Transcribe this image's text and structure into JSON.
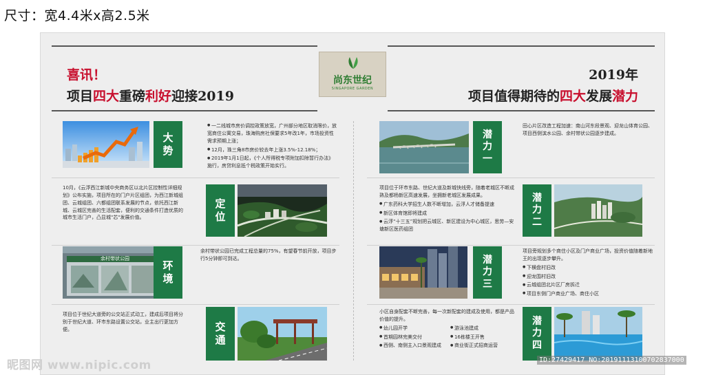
{
  "size_note": "尺寸：宽4.4米x高2.5米",
  "logo": {
    "cn": "尚东世纪",
    "en": "SINGAPORE GARDEN"
  },
  "title_left": {
    "line1": "喜讯！",
    "pre": "项目",
    "h1": "四大",
    "mid": "重磅",
    "h2": "利好",
    "post": "迎接2019"
  },
  "title_right": {
    "line1": "2019年",
    "pre": "项目值得期待的",
    "h1": "四大",
    "mid": "发展",
    "h2": "潜力"
  },
  "left_sections": [
    {
      "tag": [
        "大",
        "势"
      ],
      "text": [
        "一二线城市房价调控政策放宽，广州部分地区取消限价，放宽商住公寓交易，珠海购房社保要求5年改1年，市场投资性需求预期上涨；",
        "12月，珠三角8市房价较去年上涨3.5%-12.18%；",
        "2019年1月1日起，《个人所得税专项附加扣除暂行办法》施行，房贷利息抵个税政策开始实行。"
      ]
    },
    {
      "tag": [
        "定",
        "位"
      ],
      "text": "10月，《云浮西江新城中央商务区以北片区控制性详细规划》公布实施，项目所在的门户片区组团，为西江新城组团、云城组团、六都组团联系发展的节点，依托西江新城、云城区完善的生活配套，便利的交通条件打造优质的城市生活门户，凸显城\"芯\"发展价值。"
    },
    {
      "tag": [
        "环",
        "境"
      ],
      "text": "余村带状公园已完成工程总量的75%，有望春节前开放，项目步行5分钟即可到达。",
      "sign": "余村带状公园"
    },
    {
      "tag": [
        "交",
        "通"
      ],
      "text": "项目位于世纪大道旁的公交站正式动工，建成后项目将分别于世纪大道、环市东路设置公交站，业主出行更加方便。"
    }
  ],
  "right_sections": [
    {
      "tag": [
        "潜",
        "力",
        "一"
      ],
      "text": "田心片区改造工程加速：南山河东段景观、迎龙山体育公园、项目西侧滨水公园、余村带状公园逐步建成。"
    },
    {
      "tag": [
        "潜",
        "力",
        "二"
      ],
      "text": "项目位于环市东路、世纪大道及新城快线旁，随着老城区不断成熟及都杨新区高速发展，坐拥新老城区发展成果。",
      "bullets": [
        "广东药科大学招生人数不断增加，云浮人才储备提速",
        "新区体育馆即将建成",
        "云浮“十三五”规划把云城区、新区建设为中心城区，思劳—安塘新区医药组团"
      ]
    },
    {
      "tag": [
        "潜",
        "力",
        "三"
      ],
      "text": "项目旁规划多个商住小区及门户商业广场，投资价值随着新地王的出现逐步攀升。",
      "bullets": [
        "下横盘村旧改",
        "迎龙围村旧改",
        "云城组团北片区厂房拆迁",
        "项目东侧门户商业广场、商住小区"
      ]
    },
    {
      "tag": [
        "潜",
        "力",
        "四"
      ],
      "text": "小区自身配套不断完善，每一次新配套的建成及使用，都是产品价值的提升。",
      "bullets_grid": [
        "幼儿园开学",
        "游泳池建成",
        "首期园林完美交付",
        "16栋楼王开售",
        "西侧、南侧主入口景观建成",
        "商业街正式招商运营"
      ]
    }
  ],
  "watermark": {
    "left": "昵图网 www.nipic.com",
    "right": "ID:27429417 NO:20191113100702837000"
  },
  "colors": {
    "green": "#1e7a46",
    "red": "#c8102e",
    "board": "#eeeeee"
  }
}
